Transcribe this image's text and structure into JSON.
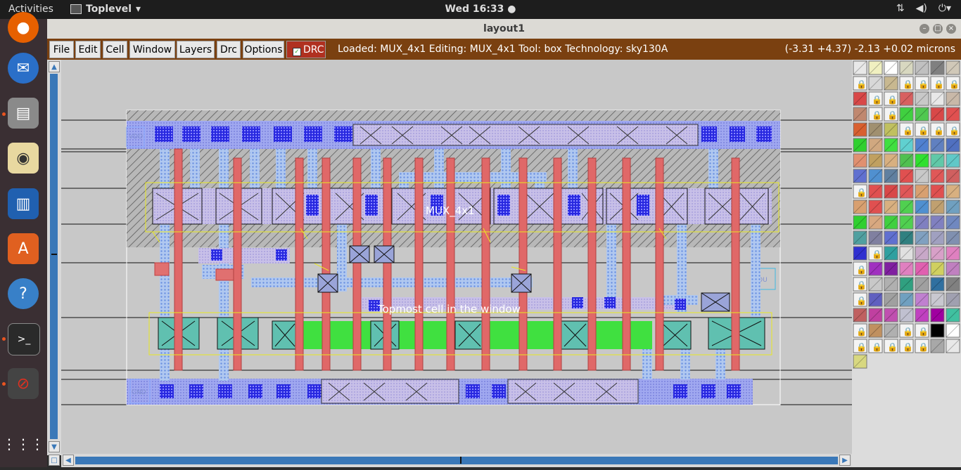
{
  "topbar": {
    "activities": "Activities",
    "app_name": "Toplevel",
    "app_arrow": "▾",
    "clock": "Wed 16:33 ●",
    "tray_icons": [
      "network-icon",
      "volume-icon",
      "power-icon"
    ]
  },
  "window": {
    "title": "layout1",
    "controls": [
      "minimize",
      "maximize",
      "close"
    ]
  },
  "menubar": {
    "items": [
      "File",
      "Edit",
      "Cell",
      "Window",
      "Layers",
      "Drc",
      "Options"
    ],
    "drc_toggle": "DRC",
    "drc_checked": true,
    "status": "Loaded: MUX_4x1 Editing: MUX_4x1 Tool: box  Technology: sky130A",
    "coords": "(-3.31 +4.37) -2.13 +0.02 microns"
  },
  "layout": {
    "cell_name": "MUX_4x1",
    "topmost_label": "Topmost cell in the window",
    "pins": {
      "vdd": "VDD",
      "gnd": "GND",
      "out": "OU"
    }
  },
  "dock": [
    "firefox-icon",
    "thunderbird-icon",
    "files-icon",
    "rhythmbox-icon",
    "writer-icon",
    "software-icon",
    "help-icon",
    "terminal-icon",
    "blocked-icon",
    "app-grid-icon"
  ],
  "colors": {
    "menubar_bg": "#7a4010",
    "drc_bg": "#b03020",
    "canvas_bg": "#c8c8c8",
    "poly": "#e07070",
    "metal1": "#8c96f0",
    "diffusion": "#40e040",
    "contact": "#2020e0"
  },
  "palette": {
    "rows": [
      [
        "#e8e8e8",
        "#f0f0c0",
        "#ffffff",
        "#d8d8c0",
        "#c0c0c0",
        "#808080",
        "#d0c8b8"
      ],
      [
        "lock",
        "#d8d8d8",
        "#c8b890",
        "lock",
        "lock",
        "lock",
        "lock"
      ],
      [
        "#d84848",
        "lock",
        "lock",
        "#d86060",
        "#c8c8c8",
        "#e8e8e8",
        "#c8b8a8"
      ],
      [
        "#c08870",
        "lock",
        "lock",
        "#40d040",
        "#50c850",
        "#d84848",
        "#e05050"
      ],
      [
        "#d86030",
        "#a09070",
        "#c0c060",
        "lock",
        "lock",
        "lock",
        "lock"
      ],
      [
        "#30d030",
        "#d0a880",
        "#40e040",
        "#60d0d0",
        "#5080d0",
        "#6080c0",
        "#5070c0"
      ],
      [
        "#e09070",
        "#c0a060",
        "#d8b080",
        "#50c050",
        "#30e030",
        "#60c8a8",
        "#60c8c8"
      ],
      [
        "#6070d0",
        "#5090d0",
        "#6080a0",
        "#e05050",
        "#c8c8c8",
        "#e05858",
        "#d06060"
      ],
      [
        "lock",
        "#e05050",
        "#d84848",
        "#e05858",
        "#d8a070",
        "#e05050",
        "#d8b080"
      ],
      [
        "#d8a070",
        "#e05050",
        "#d8b080",
        "#50d050",
        "#5090d0",
        "#c0a070",
        "#70a0c0"
      ],
      [
        "#30d030",
        "#d8a880",
        "#40d040",
        "#50d050",
        "#8080c0",
        "#8080c0",
        "#7088c0"
      ],
      [
        "#50a0a0",
        "#8080a0",
        "#6070d0",
        "#308080",
        "#80a0c0",
        "#a0a0c0",
        "#8090b0"
      ],
      [
        "#3030d0",
        "lock",
        "#30a0a0",
        "#e0e0e0",
        "#c8a8c8",
        "#d8a0c8",
        "#e080c0"
      ],
      [
        "lock",
        "#a030c0",
        "#8020a0",
        "#e080c0",
        "#e060b0",
        "#d0d060",
        "#c080c0"
      ],
      [
        "lock",
        "#c8c8c8",
        "#b0b0b0",
        "#30a080",
        "#a0a0a0",
        "#3070a0",
        "#808080"
      ],
      [
        "lock",
        "#6060c0",
        "#a0a0a0",
        "#70a0c0",
        "#c080d0",
        "#c8c8d0",
        "#a0a0b0"
      ],
      [
        "#c06060",
        "#c040a0",
        "#c050b0",
        "#c0c0d0",
        "#c040c0",
        "#a000a0",
        "#40c0a0"
      ],
      [
        "lock",
        "#c09060",
        "#b0b0b0",
        "lock",
        "lock",
        "#000000",
        "#ffffff"
      ],
      [
        "lock",
        "lock",
        "lock",
        "lock",
        "lock",
        "#a8a8a8",
        "#e8e8e8"
      ],
      [
        "#d8d880"
      ]
    ]
  }
}
